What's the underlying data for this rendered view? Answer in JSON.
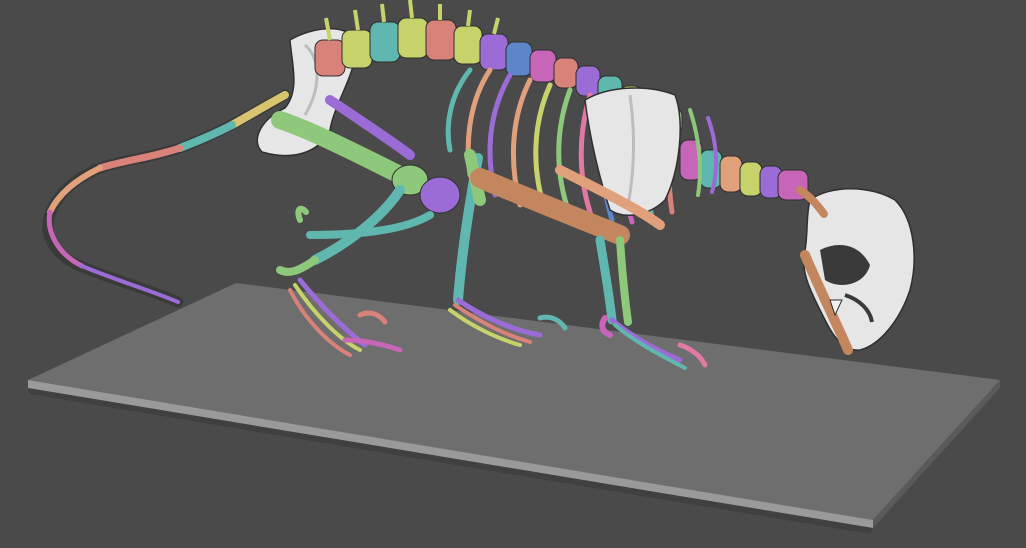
{
  "scene": {
    "background_color": "#4a4a4a",
    "subject": "skeleton-render",
    "base_plate": {
      "top_color": "#6e6e6e",
      "edge_color": "#9a9a9a",
      "shadow_color": "#3b3b3b"
    },
    "bone_palette": {
      "white": "#e6e6e6",
      "green": "#8ec87a",
      "lime": "#c7d36a",
      "yellow": "#d8c46e",
      "salmon": "#d9827a",
      "peach": "#e0a07c",
      "copper": "#c4865e",
      "teal": "#5fb7b0",
      "blue": "#5c86c8",
      "purple": "#9b6cd6",
      "magenta": "#c765b8",
      "pink": "#e07aa3"
    }
  }
}
